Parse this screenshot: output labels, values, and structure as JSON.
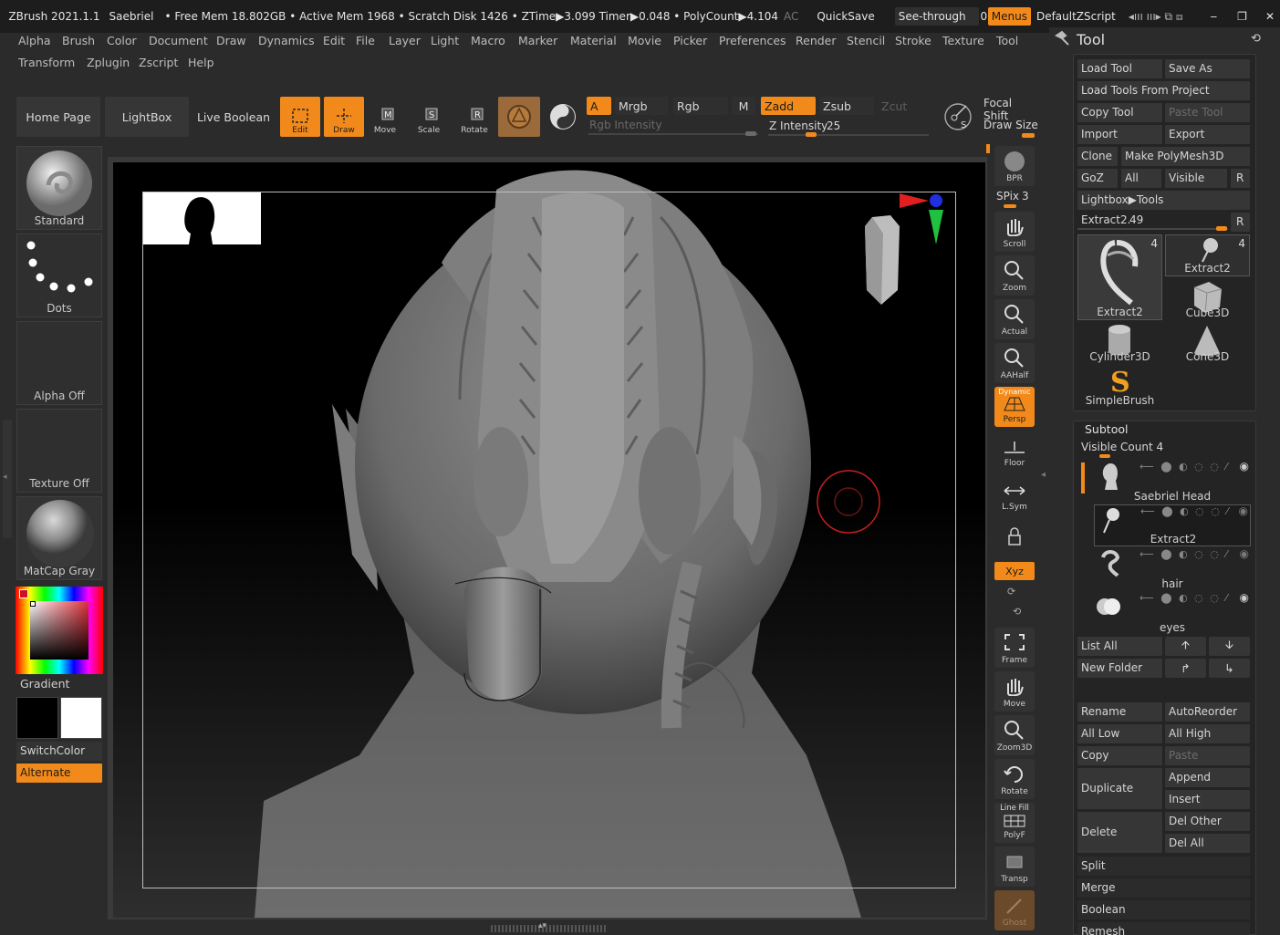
{
  "titlebar": {
    "app": "ZBrush 2021.1.1",
    "doc": "Saebriel",
    "status": "• Free Mem 18.802GB • Active Mem 1968 • Scratch Disk 1426 • ZTime▶3.099 Timer▶0.048 • PolyCount▶4.104",
    "ac": "AC",
    "quicksave": "QuickSave",
    "see_through_label": "See-through",
    "see_through_value": "0",
    "menus": "Menus",
    "zscript": "DefaultZScript"
  },
  "menubar": {
    "row1": [
      "Alpha",
      "Brush",
      "Color",
      "Document",
      "Draw",
      "Dynamics",
      "Edit",
      "File",
      "Layer",
      "Light",
      "Macro",
      "Marker",
      "Material",
      "Movie",
      "Picker",
      "Preferences",
      "Render",
      "Stencil",
      "Stroke",
      "Texture",
      "Tool"
    ],
    "row2": [
      "Transform",
      "Zplugin",
      "Zscript",
      "Help"
    ]
  },
  "toolbar": {
    "home": "Home Page",
    "lightbox": "LightBox",
    "live_boolean": "Live Boolean",
    "edit": "Edit",
    "draw": "Draw",
    "move": "Move",
    "scale": "Scale",
    "rotate": "Rotate",
    "a": "A",
    "mrgb": "Mrgb",
    "rgb": "Rgb",
    "m": "M",
    "zadd": "Zadd",
    "zsub": "Zsub",
    "zcut": "Zcut",
    "rgb_intensity": "Rgb Intensity",
    "z_intensity_label": "Z Intensity",
    "z_intensity_value": "25",
    "z_intensity_level": 0.25,
    "focal_shift": "Focal Shift",
    "draw_size": "Draw Size"
  },
  "leftshelf": {
    "brush": "Standard",
    "stroke": "Dots",
    "alpha": "Alpha Off",
    "texture": "Texture Off",
    "material": "MatCap Gray",
    "gradient": "Gradient",
    "switchcolor": "SwitchColor",
    "alternate": "Alternate"
  },
  "rightshelf": {
    "bpr": "BPR",
    "spix_label": "SPix",
    "spix_value": "3",
    "scroll": "Scroll",
    "zoom": "Zoom",
    "actual": "Actual",
    "aahalf": "AAHalf",
    "persp_top": "Dynamic",
    "persp": "Persp",
    "floor": "Floor",
    "lsym": "L.Sym",
    "xyz": "Xyz",
    "frame": "Frame",
    "move": "Move",
    "zoom3d": "Zoom3D",
    "rotate": "Rotate",
    "linefill": "Line Fill",
    "polyf": "PolyF",
    "transp": "Transp",
    "ghost": "Ghost"
  },
  "toolpanel": {
    "title": "Tool",
    "load_tool": "Load Tool",
    "save_as": "Save As",
    "load_from_project": "Load Tools From Project",
    "copy_tool": "Copy Tool",
    "paste_tool": "Paste Tool",
    "import": "Import",
    "export": "Export",
    "clone": "Clone",
    "make_polymesh": "Make PolyMesh3D",
    "goz": "GoZ",
    "all": "All",
    "visible": "Visible",
    "r": "R",
    "lightbox_tools": "Lightbox▶Tools",
    "slider_label": "Extract2.",
    "slider_value": "49",
    "thumbs": [
      {
        "name": "Extract2",
        "count": "4"
      },
      {
        "name": "Extract2",
        "count": "4"
      },
      {
        "name": "Cube3D",
        "count": ""
      },
      {
        "name": "Cylinder3D",
        "count": ""
      },
      {
        "name": "Cone3D",
        "count": ""
      },
      {
        "name": "SimpleBrush",
        "count": ""
      }
    ],
    "subtool_title": "Subtool",
    "visible_count": "Visible Count 4",
    "subtools": [
      "Saebriel Head",
      "Extract2",
      "hair",
      "eyes"
    ],
    "list_all": "List All",
    "new_folder": "New Folder",
    "rename": "Rename",
    "autoreorder": "AutoReorder",
    "all_low": "All Low",
    "all_high": "All High",
    "copy": "Copy",
    "paste": "Paste",
    "duplicate": "Duplicate",
    "append": "Append",
    "insert": "Insert",
    "delete": "Delete",
    "del_other": "Del Other",
    "del_all": "Del All",
    "split": "Split",
    "merge": "Merge",
    "boolean": "Boolean",
    "remesh": "Remesh"
  }
}
